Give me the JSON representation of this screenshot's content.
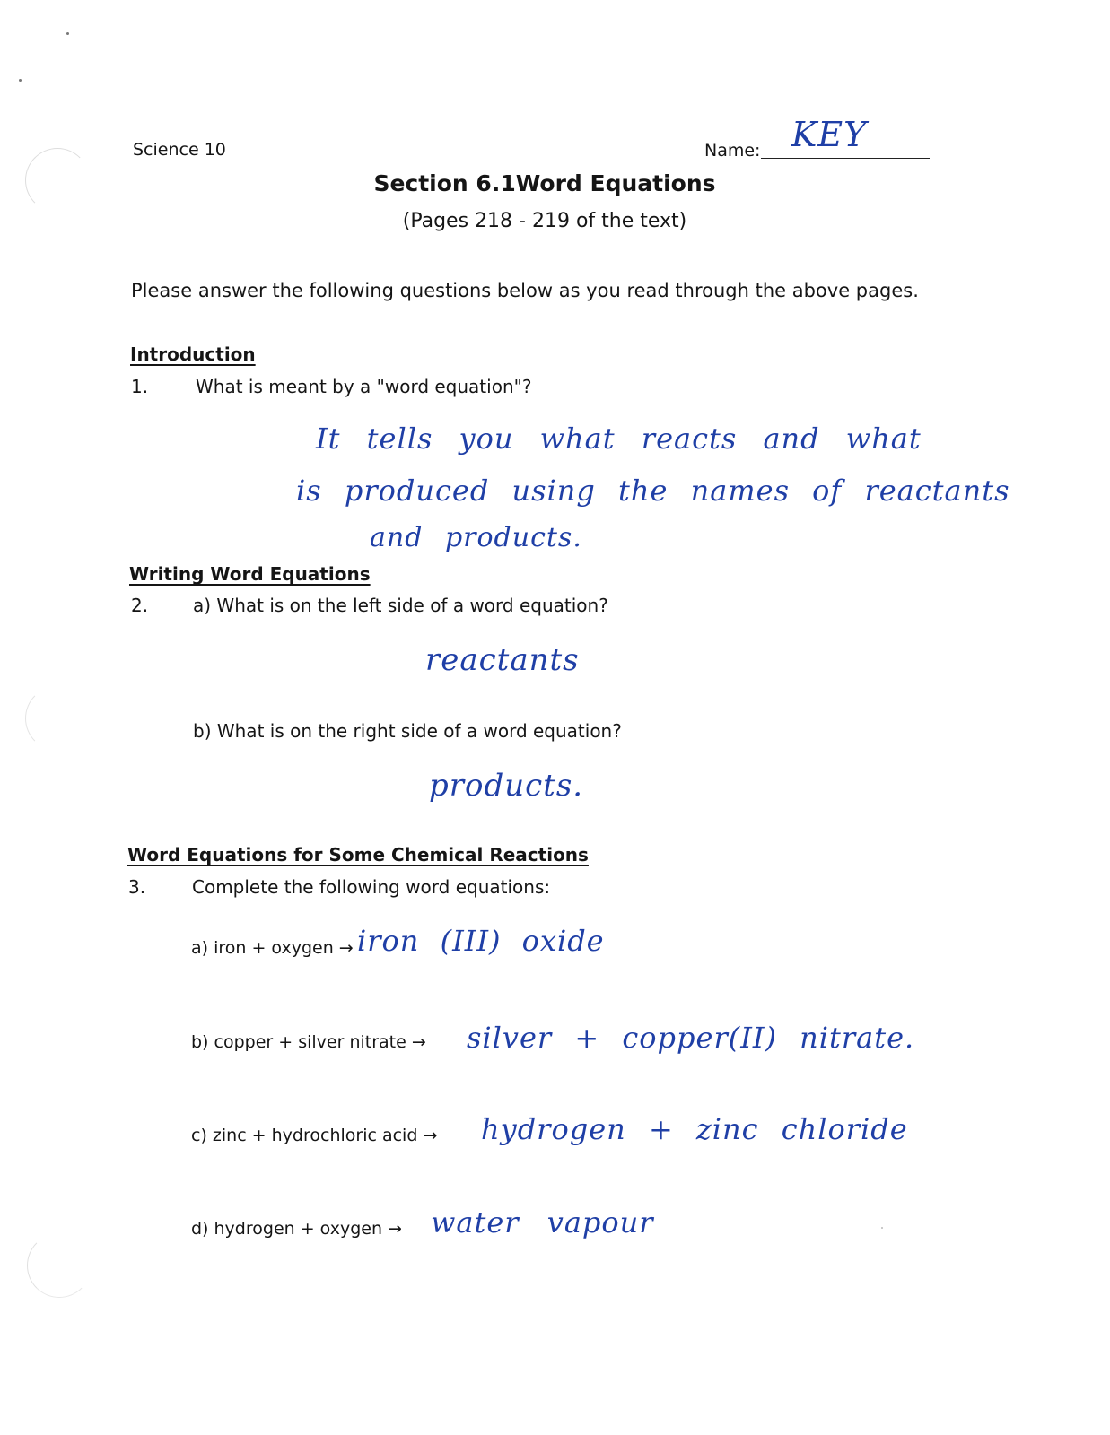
{
  "header": {
    "course": "Science 10",
    "name_label": "Name:",
    "name_value": "KEY",
    "title": "Section 6.1Word Equations",
    "subtitle": "(Pages 218 - 219 of the text)"
  },
  "instructions": "Please answer the following questions below as you read through the above pages.",
  "sections": [
    {
      "heading": "Introduction",
      "questions": [
        {
          "number": "1.",
          "text": "What is meant by a \"word equation\"?",
          "answer_lines": [
            "It tells you what reacts and what",
            "is produced using the names of reactants",
            "and products."
          ]
        }
      ]
    },
    {
      "heading": "Writing Word Equations",
      "questions": [
        {
          "number": "2.",
          "parts": [
            {
              "text": "a) What is on the left side of a word equation?",
              "answer": "reactants"
            },
            {
              "text": "b) What is on the right side of a word equation?",
              "answer": "products."
            }
          ]
        }
      ]
    },
    {
      "heading": "Word Equations for Some Chemical Reactions",
      "questions": [
        {
          "number": "3.",
          "text": "Complete the following word equations:",
          "equations": [
            {
              "prompt": "a) iron + oxygen →",
              "answer": "iron (III) oxide"
            },
            {
              "prompt": "b) copper + silver nitrate →",
              "answer": "silver + copper(II) nitrate."
            },
            {
              "prompt": "c) zinc + hydrochloric acid →",
              "answer": "hydrogen + zinc chloride"
            },
            {
              "prompt": "d) hydrogen + oxygen →",
              "answer": "water vapour"
            }
          ]
        }
      ]
    }
  ],
  "colors": {
    "ink_handwriting": "#1f3fa6",
    "print_text": "#151515"
  }
}
